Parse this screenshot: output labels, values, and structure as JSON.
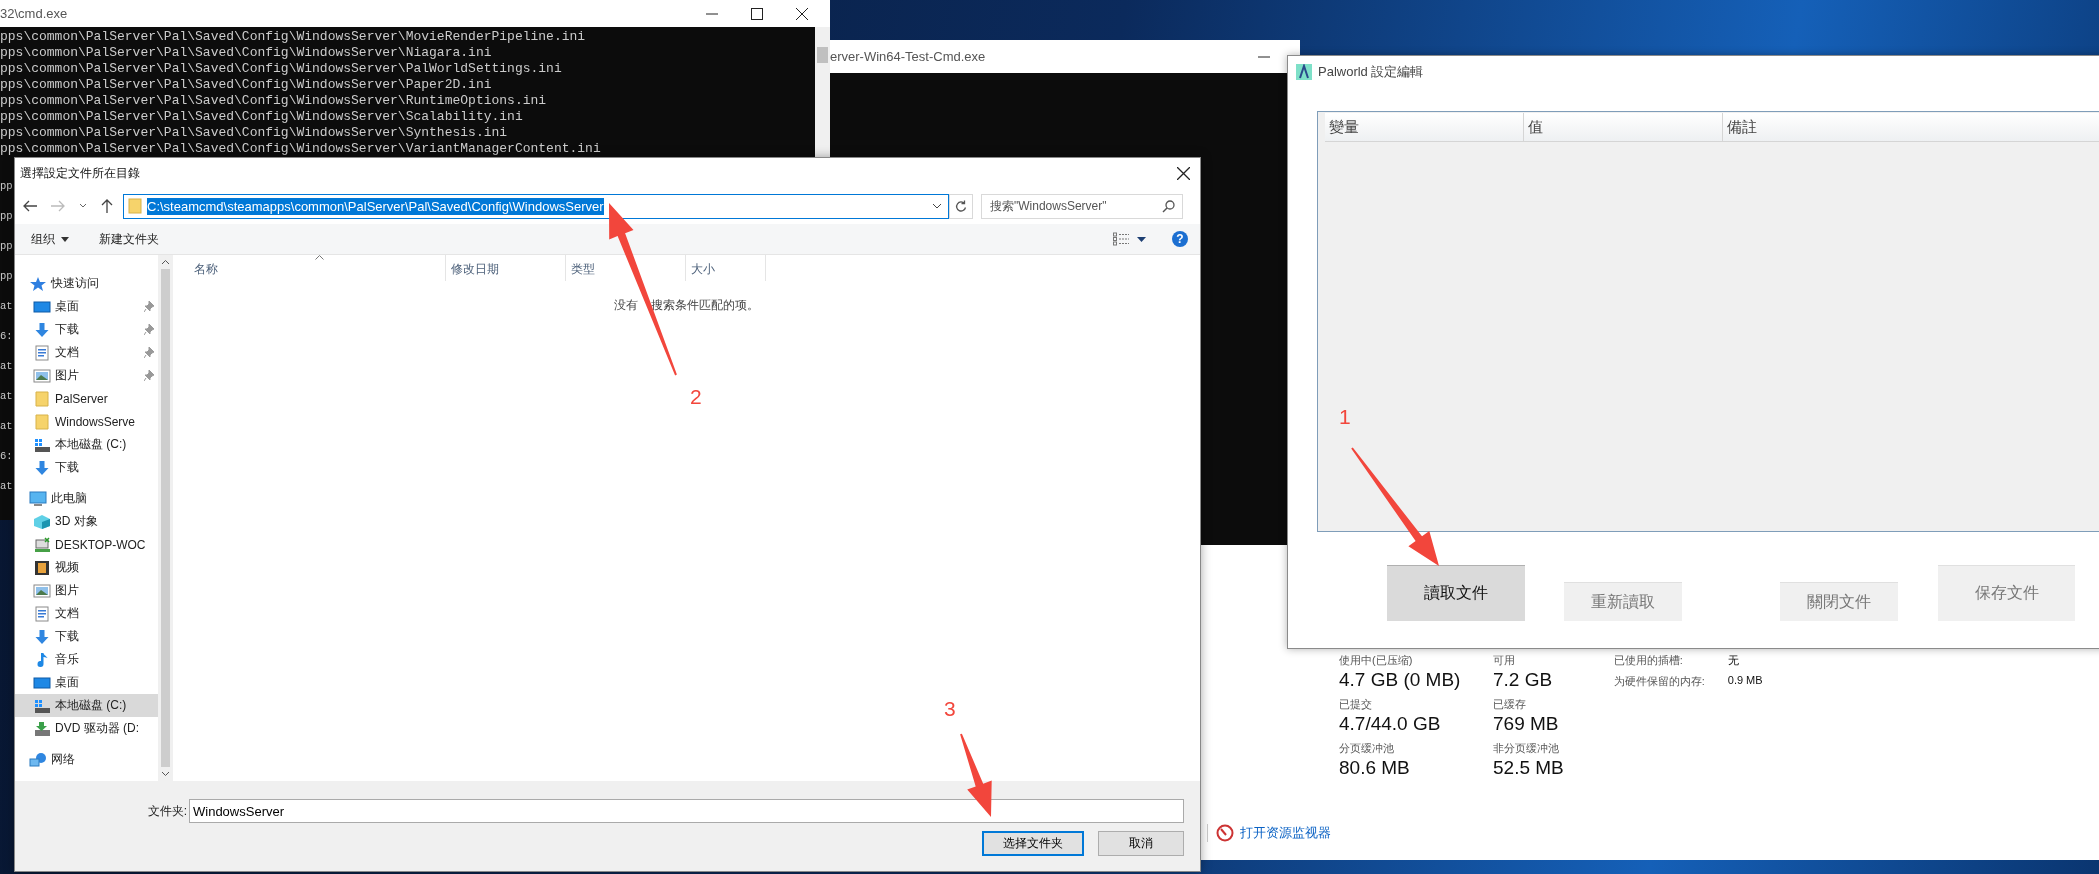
{
  "console_window": {
    "title": "32\\cmd.exe",
    "lines": [
      "pps\\common\\PalServer\\Pal\\Saved\\Config\\WindowsServer\\MovieRenderPipeline.ini",
      "pps\\common\\PalServer\\Pal\\Saved\\Config\\WindowsServer\\Niagara.ini",
      "pps\\common\\PalServer\\Pal\\Saved\\Config\\WindowsServer\\PalWorldSettings.ini",
      "pps\\common\\PalServer\\Pal\\Saved\\Config\\WindowsServer\\Paper2D.ini",
      "pps\\common\\PalServer\\Pal\\Saved\\Config\\WindowsServer\\RuntimeOptions.ini",
      "pps\\common\\PalServer\\Pal\\Saved\\Config\\WindowsServer\\Scalability.ini",
      "pps\\common\\PalServer\\Pal\\Saved\\Config\\WindowsServer\\Synthesis.ini",
      "pps\\common\\PalServer\\Pal\\Saved\\Config\\WindowsServer\\VariantManagerContent.ini"
    ],
    "edge_fragments": [
      "pp",
      "pp",
      "pp",
      "pp",
      "at",
      "6:",
      "at",
      "at",
      "at",
      "6:",
      "at"
    ]
  },
  "server_console": {
    "title": "erver-Win64-Test-Cmd.exe"
  },
  "task_manager": {
    "stat_rows": [
      {
        "stats": [
          {
            "label": "使用中(已压缩)",
            "value": "4.7 GB (0 MB)"
          },
          {
            "label": "可用",
            "value": "7.2 GB"
          }
        ]
      },
      {
        "stats": [
          {
            "label": "已提交",
            "value": "4.7/44.0 GB"
          },
          {
            "label": "已缓存",
            "value": "769 MB"
          }
        ]
      },
      {
        "stats": [
          {
            "label": "分页缓冲池",
            "value": "80.6 MB"
          },
          {
            "label": "非分页缓冲池",
            "value": "52.5 MB"
          }
        ]
      }
    ],
    "details": [
      {
        "label": "已使用的插槽:",
        "value": "无"
      },
      {
        "label": "为硬件保留的内存:",
        "value": "0.9 MB"
      }
    ],
    "link": "打开资源监视器"
  },
  "palworld_window": {
    "title": "Palworld 設定編輯",
    "columns": [
      "變量",
      "值",
      "備註"
    ],
    "buttons": [
      {
        "label": "讀取文件",
        "disabled": false
      },
      {
        "label": "重新讀取",
        "disabled": true
      },
      {
        "label": "關閉文件",
        "disabled": true
      },
      {
        "label": "保存文件",
        "disabled": true
      }
    ]
  },
  "folder_dialog": {
    "title": "選擇設定文件所在目錄",
    "address": "C:\\steamcmd\\steamapps\\common\\PalServer\\Pal\\Saved\\Config\\WindowsServer",
    "address_selected": true,
    "search": {
      "placeholder": "搜索\"WindowsServer\""
    },
    "toolbar": {
      "organize": "组织",
      "new_folder": "新建文件夹",
      "help": "?"
    },
    "sidebar": [
      {
        "label": "快速访问",
        "kind": "quick",
        "selected": false,
        "children": [
          {
            "label": "桌面",
            "kind": "desktop",
            "pinned": true,
            "selected": false
          },
          {
            "label": "下载",
            "kind": "download",
            "pinned": true,
            "selected": false
          },
          {
            "label": "文档",
            "kind": "documents",
            "pinned": true,
            "selected": false
          },
          {
            "label": "图片",
            "kind": "pictures",
            "pinned": true,
            "selected": false
          },
          {
            "label": "PalServer",
            "kind": "folder",
            "pinned": false,
            "selected": false
          },
          {
            "label": "WindowsServe",
            "kind": "folder",
            "pinned": false,
            "selected": false
          },
          {
            "label": "本地磁盘 (C:)",
            "kind": "drive",
            "pinned": false,
            "selected": false
          },
          {
            "label": "下载",
            "kind": "download",
            "pinned": false,
            "selected": false
          }
        ]
      },
      {
        "label": "此电脑",
        "kind": "pc",
        "selected": false,
        "children": [
          {
            "label": "3D 对象",
            "kind": "objects3d",
            "selected": false
          },
          {
            "label": "DESKTOP-WOC",
            "kind": "netpc",
            "selected": false
          },
          {
            "label": "视频",
            "kind": "video",
            "selected": false
          },
          {
            "label": "图片",
            "kind": "pictures",
            "selected": false
          },
          {
            "label": "文档",
            "kind": "documents",
            "selected": false
          },
          {
            "label": "下载",
            "kind": "download",
            "selected": false
          },
          {
            "label": "音乐",
            "kind": "music",
            "selected": false
          },
          {
            "label": "桌面",
            "kind": "desktop",
            "selected": false
          },
          {
            "label": "本地磁盘 (C:)",
            "kind": "drive",
            "selected": true
          },
          {
            "label": "DVD 驱动器 (D:",
            "kind": "dvd",
            "selected": false
          }
        ]
      },
      {
        "label": "网络",
        "kind": "network",
        "selected": false
      }
    ],
    "columns": [
      {
        "label": "名称",
        "sorted": true
      },
      {
        "label": "修改日期",
        "sorted": false
      },
      {
        "label": "类型",
        "sorted": false
      },
      {
        "label": "大小",
        "sorted": false
      }
    ],
    "empty_message_parts": [
      "没有",
      "搜索条件匹配的项。"
    ],
    "folder_label": "文件夹:",
    "folder_value": "WindowsServer",
    "buttons": [
      {
        "label": "选择文件夹",
        "default": true
      },
      {
        "label": "取消",
        "default": false
      }
    ]
  },
  "annotations": [
    {
      "number": "1"
    },
    {
      "number": "2"
    },
    {
      "number": "3"
    }
  ]
}
